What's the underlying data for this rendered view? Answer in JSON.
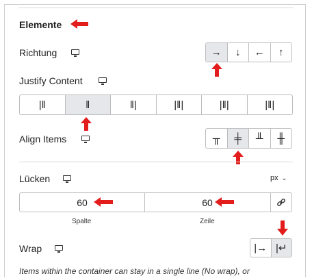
{
  "section": {
    "title": "Elemente"
  },
  "direction": {
    "label": "Richtung",
    "icon": "monitor-icon",
    "buttons": [
      {
        "icon": "arrow-right-icon",
        "glyph": "→"
      },
      {
        "icon": "arrow-down-icon",
        "glyph": "↓"
      },
      {
        "icon": "arrow-left-icon",
        "glyph": "←"
      },
      {
        "icon": "arrow-up-icon",
        "glyph": "↑"
      }
    ],
    "selected": 0
  },
  "justify": {
    "label": "Justify Content",
    "icon": "monitor-icon",
    "buttons": [
      {
        "icon": "justify-start-icon",
        "glyph": "|‖"
      },
      {
        "icon": "justify-center-icon",
        "glyph": "‖"
      },
      {
        "icon": "justify-end-icon",
        "glyph": "‖|"
      },
      {
        "icon": "justify-space-between-icon",
        "glyph": "|‖|"
      },
      {
        "icon": "justify-space-around-icon",
        "glyph": "|‖|"
      },
      {
        "icon": "justify-space-evenly-icon",
        "glyph": "|‖|"
      }
    ],
    "selected": 1
  },
  "align": {
    "label": "Align Items",
    "icon": "monitor-icon",
    "buttons": [
      {
        "icon": "align-start-icon",
        "glyph": "╥"
      },
      {
        "icon": "align-center-icon",
        "glyph": "╪"
      },
      {
        "icon": "align-end-icon",
        "glyph": "╨"
      },
      {
        "icon": "align-stretch-icon",
        "glyph": "╫"
      }
    ],
    "selected": 1
  },
  "gaps": {
    "label": "Lücken",
    "icon": "monitor-icon",
    "unit": "px",
    "column": {
      "value": "60",
      "caption": "Spalte"
    },
    "row": {
      "value": "60",
      "caption": "Zeile"
    },
    "link_icon": "link-icon"
  },
  "wrap": {
    "label": "Wrap",
    "icon": "monitor-icon",
    "buttons": [
      {
        "icon": "no-wrap-icon",
        "glyph": "|→"
      },
      {
        "icon": "wrap-icon",
        "glyph": "|↵"
      }
    ],
    "selected": 1
  },
  "note": "Items within the container can stay in a single line (No wrap), or",
  "colors": {
    "annotation": "#e31c1c",
    "selected_bg": "#e5e7eb"
  }
}
